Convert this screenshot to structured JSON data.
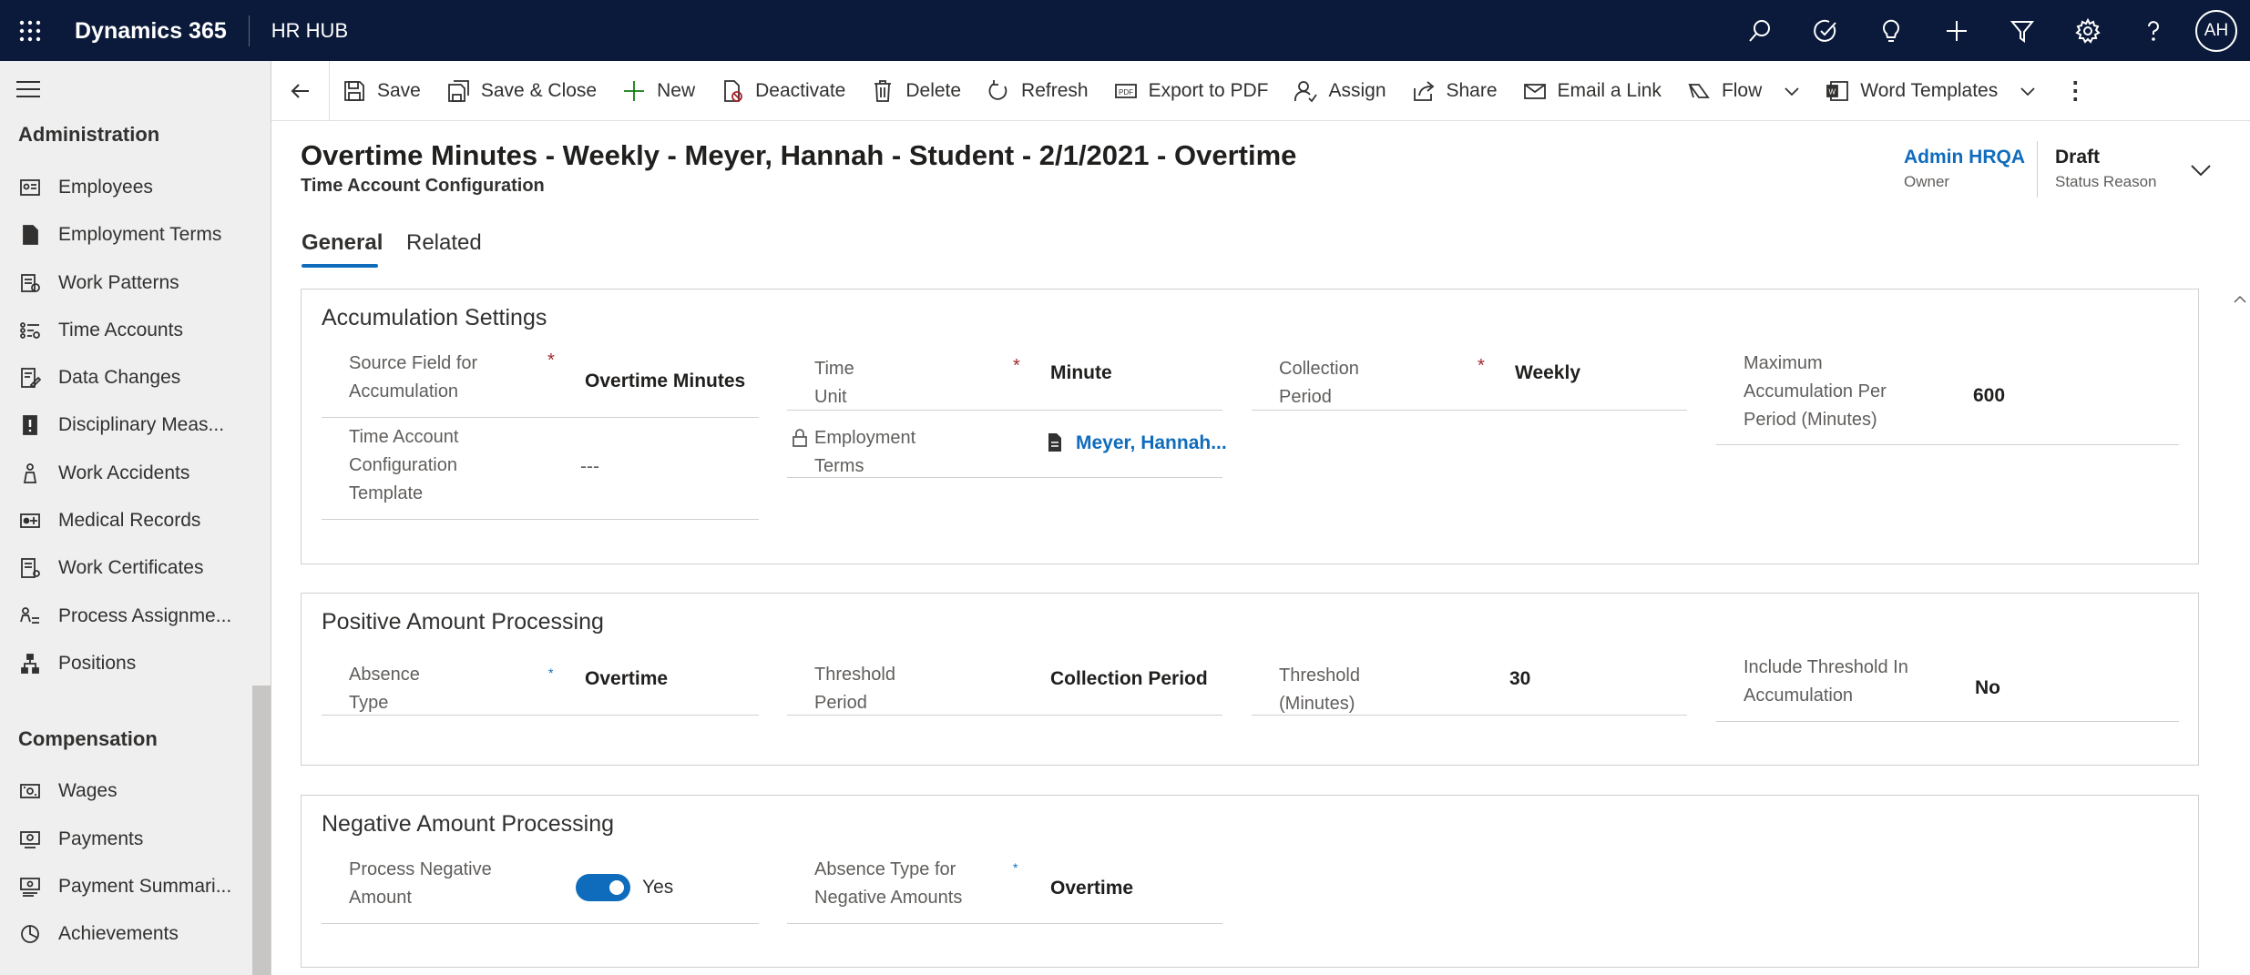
{
  "app": {
    "brand": "Dynamics 365",
    "name": "HR HUB",
    "user_initials": "AH",
    "top_icons": [
      "search-icon",
      "task-check-icon",
      "lightbulb-icon",
      "plus-icon",
      "filter-icon",
      "gear-icon",
      "help-icon"
    ]
  },
  "sidebar": {
    "groups": [
      {
        "title": "Administration",
        "items": [
          {
            "label": "Employees",
            "icon": "contact-card-icon"
          },
          {
            "label": "Employment Terms",
            "icon": "document-icon"
          },
          {
            "label": "Work Patterns",
            "icon": "work-pattern-icon"
          },
          {
            "label": "Time Accounts",
            "icon": "list-settings-icon"
          },
          {
            "label": "Data Changes",
            "icon": "data-change-icon"
          },
          {
            "label": "Disciplinary Meas...",
            "icon": "alert-document-icon"
          },
          {
            "label": "Work Accidents",
            "icon": "person-accident-icon"
          },
          {
            "label": "Medical Records",
            "icon": "medical-card-icon"
          },
          {
            "label": "Work Certificates",
            "icon": "certificate-icon"
          },
          {
            "label": "Process Assignme...",
            "icon": "people-process-icon"
          },
          {
            "label": "Positions",
            "icon": "org-chart-icon"
          }
        ]
      },
      {
        "title": "Compensation",
        "items": [
          {
            "label": "Wages",
            "icon": "money-icon"
          },
          {
            "label": "Payments",
            "icon": "payment-icon"
          },
          {
            "label": "Payment Summari...",
            "icon": "payment-summary-icon"
          },
          {
            "label": "Achievements",
            "icon": "pie-chart-icon"
          }
        ]
      }
    ]
  },
  "commands": [
    {
      "label": "Save",
      "icon": "save-icon"
    },
    {
      "label": "Save & Close",
      "icon": "save-close-icon"
    },
    {
      "label": "New",
      "icon": "plus-icon"
    },
    {
      "label": "Deactivate",
      "icon": "deactivate-icon"
    },
    {
      "label": "Delete",
      "icon": "trash-icon"
    },
    {
      "label": "Refresh",
      "icon": "refresh-icon"
    },
    {
      "label": "Export to PDF",
      "icon": "pdf-icon"
    },
    {
      "label": "Assign",
      "icon": "assign-person-icon"
    },
    {
      "label": "Share",
      "icon": "share-icon"
    },
    {
      "label": "Email a Link",
      "icon": "email-link-icon"
    },
    {
      "label": "Flow",
      "icon": "flow-icon"
    },
    {
      "label": "Word Templates",
      "icon": "word-template-icon"
    }
  ],
  "record": {
    "title": "Overtime Minutes - Weekly - Meyer, Hannah  - Student - 2/1/2021  - Overtime",
    "entity": "Time Account Configuration",
    "owner_value": "Admin HRQA",
    "owner_caption": "Owner",
    "status_value": "Draft",
    "status_caption": "Status Reason"
  },
  "tabs": [
    {
      "label": "General",
      "active": true
    },
    {
      "label": "Related",
      "active": false
    }
  ],
  "sections": {
    "accumulation": {
      "title": "Accumulation Settings",
      "source_field_label": "Source Field for Accumulation",
      "source_field_value": "Overtime Minutes",
      "template_label": "Time Account Configuration Template",
      "template_value": "---",
      "time_unit_label": "Time Unit",
      "time_unit_value": "Minute",
      "employment_terms_label": "Employment Terms",
      "employment_terms_value": "Meyer, Hannah...",
      "collection_period_label": "Collection Period",
      "collection_period_value": "Weekly",
      "max_accumulation_label": "Maximum Accumulation Per Period (Minutes)",
      "max_accumulation_value": "600"
    },
    "positive": {
      "title": "Positive Amount Processing",
      "absence_type_label": "Absence Type",
      "absence_type_value": "Overtime",
      "threshold_period_label": "Threshold Period",
      "threshold_period_value": "Collection Period",
      "threshold_minutes_label": "Threshold (Minutes)",
      "threshold_minutes_value": "30",
      "include_threshold_label": "Include Threshold In Accumulation",
      "include_threshold_value": "No"
    },
    "negative": {
      "title": "Negative Amount Processing",
      "process_negative_label": "Process Negative Amount",
      "process_negative_value": "Yes",
      "process_negative_on": true,
      "absence_type_neg_label": "Absence Type for Negative Amounts",
      "absence_type_neg_value": "Overtime"
    }
  },
  "required_marker": "*"
}
